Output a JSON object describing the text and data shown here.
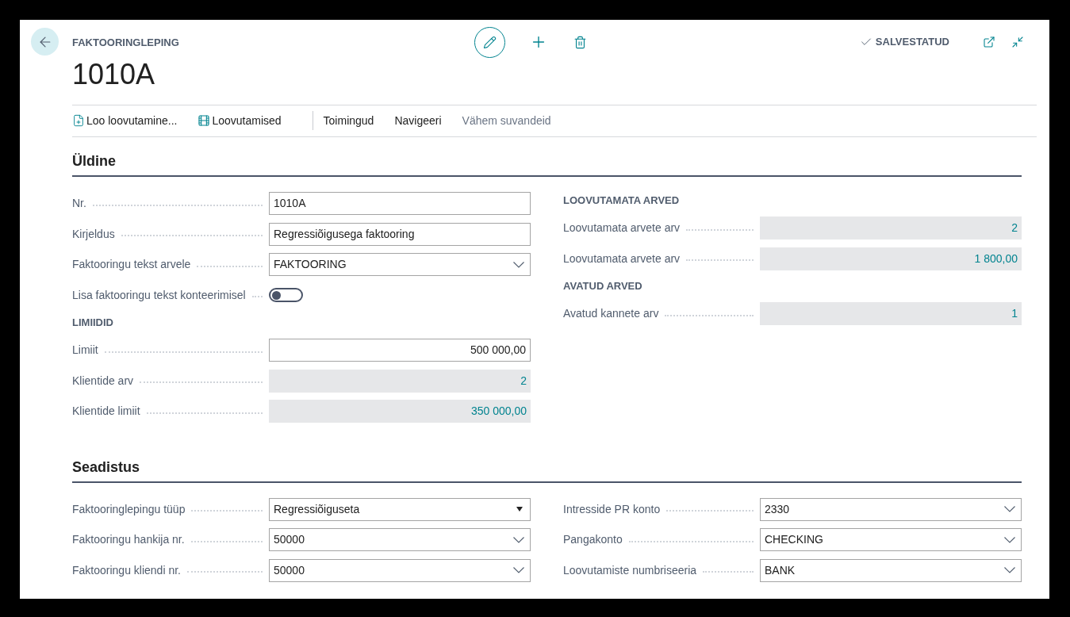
{
  "header": {
    "caption": "FAKTOORINGLEPING",
    "title": "1010A",
    "status": "SALVESTATUD"
  },
  "actions": [
    {
      "label": "Loo loovutamine...",
      "kind": "new"
    },
    {
      "label": "Loovutamised",
      "kind": "list"
    },
    {
      "label": "Toimingud",
      "kind": "menu"
    },
    {
      "label": "Navigeeri",
      "kind": "menu"
    },
    {
      "label": "Vähem suvandeid",
      "kind": "less"
    }
  ],
  "sections": [
    {
      "title": "Üldine",
      "columns": [
        [
          {
            "kind": "text",
            "label": "Nr.",
            "value": "1010A"
          },
          {
            "kind": "text",
            "label": "Kirjeldus",
            "value": "Regressiõigusega faktooring"
          },
          {
            "kind": "dropdown",
            "label": "Faktooringu tekst arvele",
            "value": "FAKTOORING"
          },
          {
            "kind": "toggle",
            "label": "Lisa faktooringu tekst konteerimisel",
            "on": false
          },
          {
            "kind": "group",
            "title": "LIMIIDID"
          },
          {
            "kind": "number",
            "label": "Limiit",
            "value": "500 000,00"
          },
          {
            "kind": "readonly",
            "label": "Klientide arv",
            "value": "2"
          },
          {
            "kind": "readonly",
            "label": "Klientide limiit",
            "value": "350 000,00"
          }
        ],
        [
          {
            "kind": "group",
            "title": "LOOVUTAMATA ARVED"
          },
          {
            "kind": "readonly",
            "label": "Loovutamata arvete arv",
            "value": "2"
          },
          {
            "kind": "readonly",
            "label": "Loovutamata arvete arv",
            "value": "1 800,00"
          },
          {
            "kind": "group",
            "title": "AVATUD ARVED"
          },
          {
            "kind": "readonly",
            "label": "Avatud kannete arv",
            "value": "1"
          }
        ]
      ]
    },
    {
      "title": "Seadistus",
      "columns": [
        [
          {
            "kind": "select",
            "label": "Faktooringlepingu tüüp",
            "value": "Regressiõiguseta"
          },
          {
            "kind": "dropdown",
            "label": "Faktooringu hankija nr.",
            "value": "50000"
          },
          {
            "kind": "dropdown",
            "label": "Faktooringu kliendi nr.",
            "value": "50000"
          }
        ],
        [
          {
            "kind": "dropdown",
            "label": "Intresside PR konto",
            "value": "2330"
          },
          {
            "kind": "dropdown",
            "label": "Pangakonto",
            "value": "CHECKING"
          },
          {
            "kind": "dropdown",
            "label": "Loovutamiste numbriseeria",
            "value": "BANK"
          }
        ]
      ]
    }
  ]
}
